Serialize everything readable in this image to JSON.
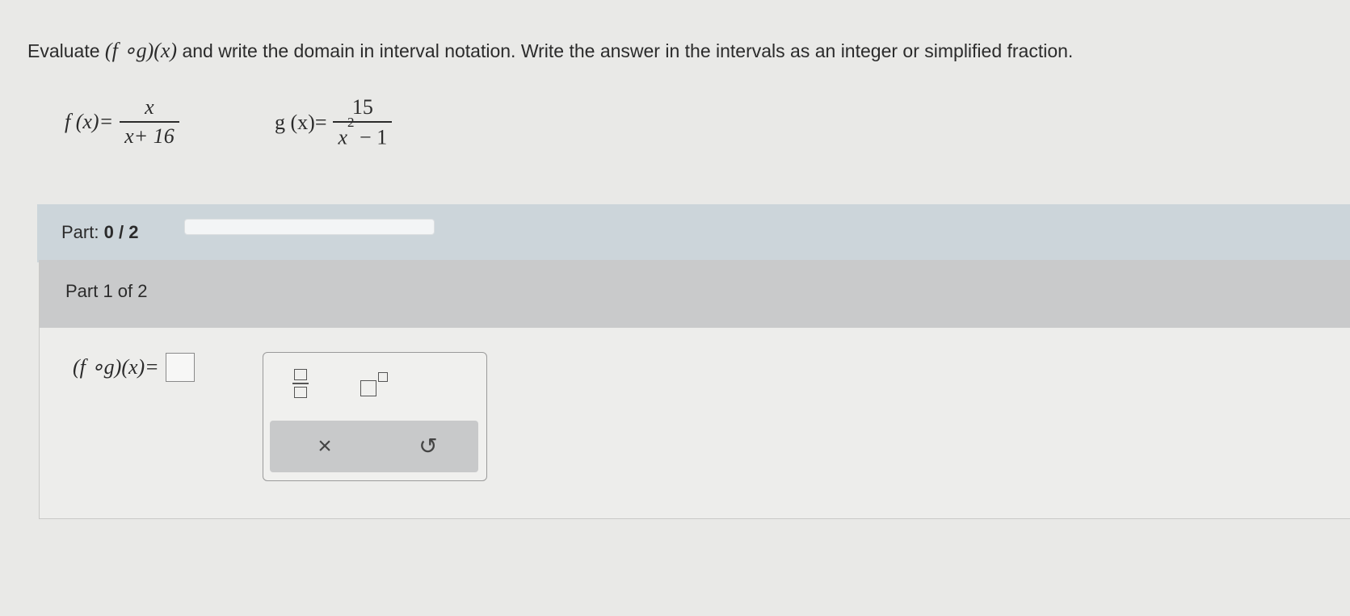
{
  "question": {
    "lead": "Evaluate ",
    "expr": "(f ∘g)(x)",
    "rest": " and write the domain in interval notation. Write the answer in the intervals as an integer or simplified fraction."
  },
  "functions": {
    "f": {
      "lhs": "f (x)=",
      "numerator": "x",
      "denominator": "x+ 16"
    },
    "g": {
      "lhs": "g (x)=",
      "numerator": "15",
      "denominator_base": "x",
      "denominator_exp": "2",
      "denominator_rest": " − 1"
    }
  },
  "part_progress": {
    "label": "Part:",
    "current": "0",
    "separator": " / ",
    "total": "2",
    "fraction_complete": 0
  },
  "panel": {
    "title": "Part 1 of 2"
  },
  "answer": {
    "lhs": "(f ∘g)(x)=",
    "value": ""
  },
  "palette": {
    "buttons": [
      "fraction-icon",
      "exponent-icon"
    ],
    "actions": {
      "clear_glyph": "×",
      "undo_glyph": "↺"
    }
  },
  "colors": {
    "progress_fill": "#4a90c2",
    "part_bar": "#ccd5da",
    "panel_header": "#c9cacb"
  }
}
